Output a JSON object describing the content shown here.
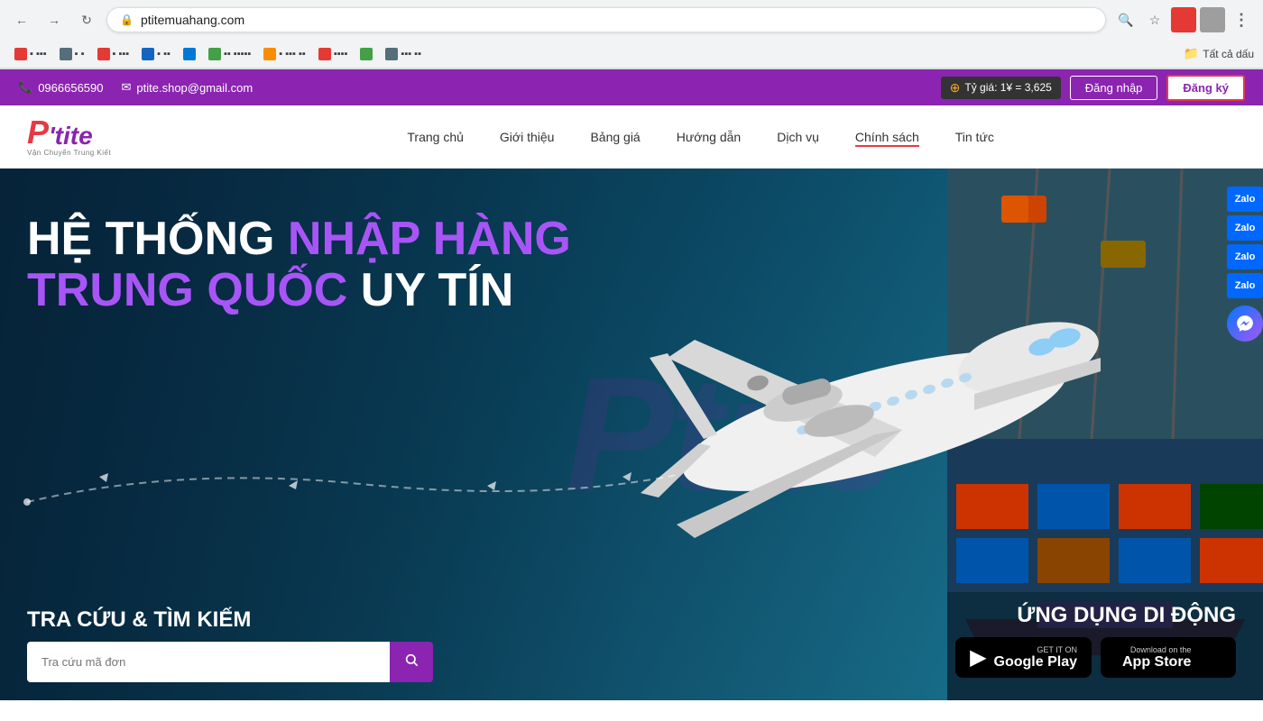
{
  "browser": {
    "url": "ptitemuahang.com",
    "back_disabled": false,
    "forward_disabled": false,
    "reload_label": "↻",
    "search_icon": "🔍",
    "star_icon": "☆",
    "profile_icon": "👤",
    "menu_icon": "⋮",
    "bookmarks_folder": "Tất cả dấu"
  },
  "topbar": {
    "phone": "0966656590",
    "email": "ptite.shop@gmail.com",
    "exchange_label": "Tỷ giá: 1¥ = 3,625",
    "login_label": "Đăng nhập",
    "register_label": "Đăng ký"
  },
  "nav": {
    "logo_p": "P",
    "logo_tite": "'tite",
    "logo_subtitle": "Vận Chuyển Trung Kiết",
    "links": [
      {
        "label": "Trang chủ",
        "active": false
      },
      {
        "label": "Giới thiệu",
        "active": false
      },
      {
        "label": "Bảng giá",
        "active": false
      },
      {
        "label": "Hướng dẫn",
        "active": false
      },
      {
        "label": "Dịch vụ",
        "active": false
      },
      {
        "label": "Chính sách",
        "active": true
      },
      {
        "label": "Tin tức",
        "active": false
      }
    ]
  },
  "hero": {
    "title_line1_white": "HỆ THỐNG ",
    "title_line1_purple": "NHẬP HÀNG",
    "title_line2_purple": "TRUNG QUỐC ",
    "title_line2_white": "UY TÍN",
    "watermark": "Ptite"
  },
  "search": {
    "title": "TRA CỨU & TÌM KIẾM",
    "placeholder": "Tra cứu mã đơn",
    "btn_icon": "🔍"
  },
  "app": {
    "title": "ỨNG DỤNG DI ĐỘNG",
    "google_play_label": "GET IT ON",
    "google_play_store": "Google Play",
    "apple_label": "Download on the",
    "apple_store": "App Store"
  },
  "sidebar": {
    "zalo_labels": [
      "Zalo",
      "Zalo",
      "Zalo",
      "Zalo"
    ],
    "messenger_icon": "💬"
  }
}
